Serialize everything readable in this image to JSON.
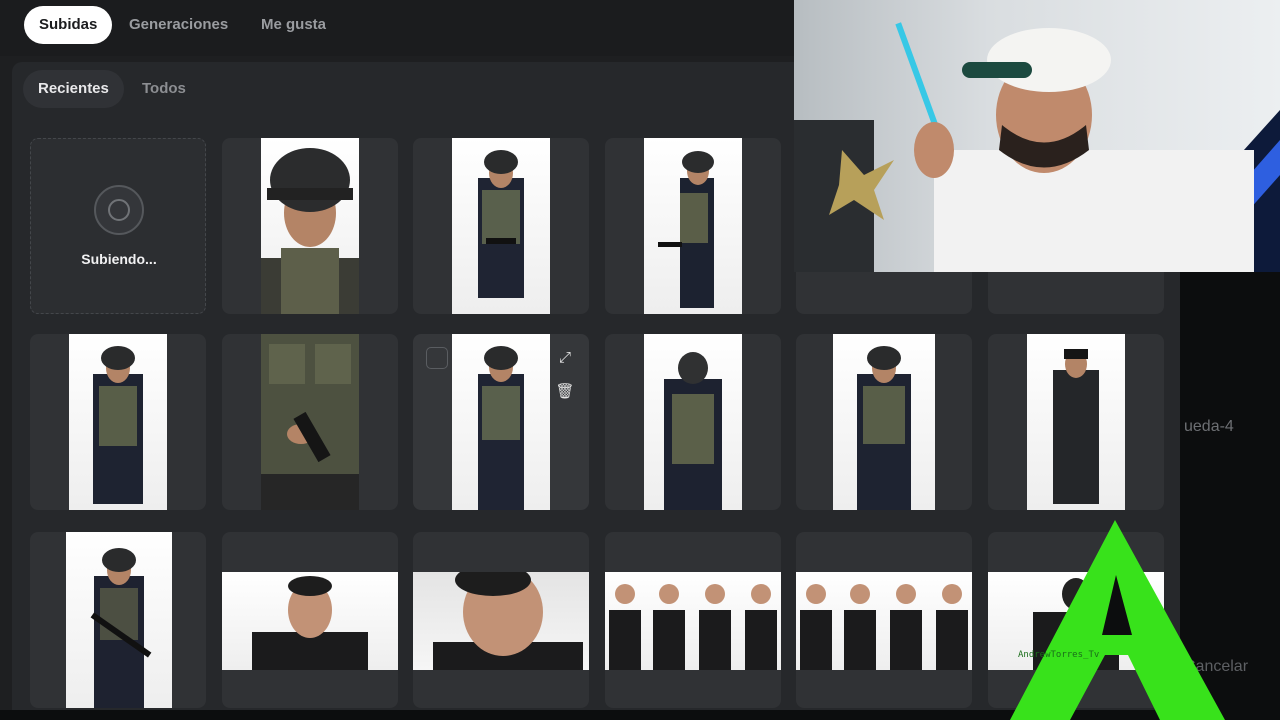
{
  "tabs": [
    {
      "label": "Subidas",
      "active": true
    },
    {
      "label": "Generaciones",
      "active": false
    },
    {
      "label": "Me gusta",
      "active": false
    }
  ],
  "subtabs": [
    {
      "label": "Recientes",
      "active": true
    },
    {
      "label": "Todos",
      "active": false
    }
  ],
  "upload_tile": {
    "label": "Subiendo..."
  },
  "side_panel": {
    "search_fragment": "ueda-4",
    "cancel_label": "Cancelar"
  },
  "overlay": {
    "watermark": "AndrewTorres_Tv"
  },
  "icons": {
    "expand": "expand-icon",
    "delete": "trash-icon",
    "spinner": "loading-spinner-icon"
  },
  "colors": {
    "background": "#1e1f21",
    "tile": "#303235",
    "active_tab": "#ffffff",
    "accent_logo": "#38e21b"
  }
}
